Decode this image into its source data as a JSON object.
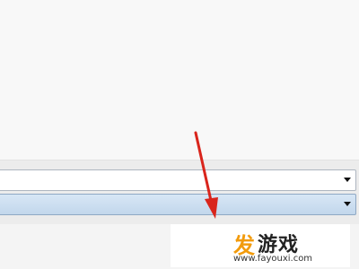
{
  "dropdowns": [
    {
      "value": ""
    },
    {
      "value": ""
    }
  ],
  "watermark": {
    "icon": "发",
    "text": "游戏",
    "url": "www.fayouxi.com"
  },
  "annotation": {
    "icon": "red-arrow-icon",
    "color": "#d9251c"
  },
  "colors": {
    "selected_dropdown": "#c8dcf0",
    "watermark_accent": "#f29b0c"
  }
}
